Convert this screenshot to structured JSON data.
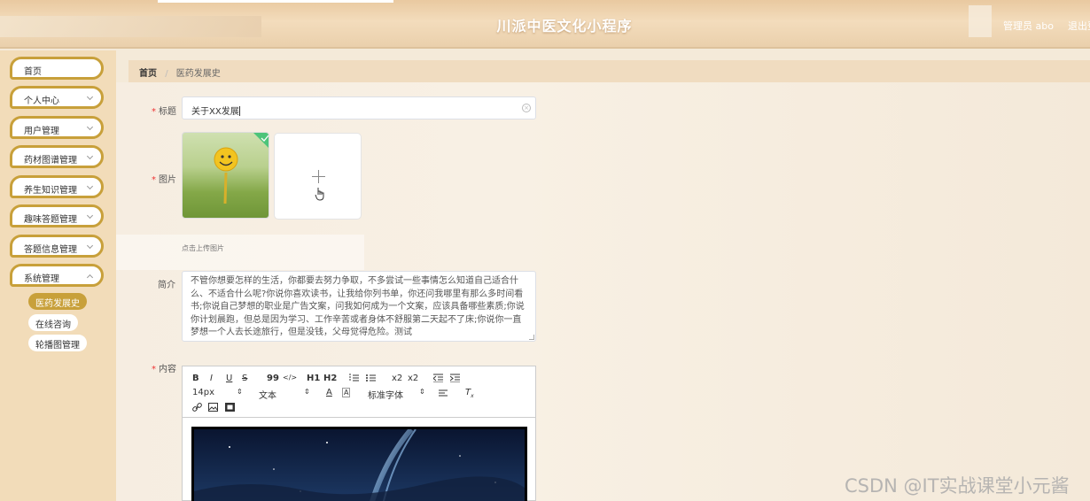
{
  "header": {
    "title": "川派中医文化小程序",
    "admin": "管理员 abo",
    "logout": "退出登"
  },
  "sidebar": {
    "items": [
      {
        "label": "首页"
      },
      {
        "label": "个人中心"
      },
      {
        "label": "用户管理"
      },
      {
        "label": "药材图谱管理"
      },
      {
        "label": "养生知识管理"
      },
      {
        "label": "趣味答题管理"
      },
      {
        "label": "答题信息管理"
      },
      {
        "label": "系统管理"
      }
    ],
    "sub_items": [
      {
        "label": "医药发展史",
        "active": true
      },
      {
        "label": "在线咨询"
      },
      {
        "label": "轮播图管理"
      }
    ]
  },
  "breadcrumb": {
    "home": "首页",
    "separator": "/",
    "current": "医药发展史"
  },
  "form": {
    "title_label": "标题",
    "title_value": "关于XX发展",
    "image_label": "图片",
    "upload_hint": "点击上传图片",
    "intro_label": "简介",
    "intro_value": "不管你想要怎样的生活，你都要去努力争取，不多尝试一些事情怎么知道自己适合什么、不适合什么呢?你说你喜欢读书，让我给你列书单，你还问我哪里有那么多时间看书;你说自己梦想的职业是广告文案，问我如何成为一个文案，应该具备哪些素质;你说你计划晨跑，但总是因为学习、工作辛苦或者身体不舒服第二天起不了床;你说你一直梦想一个人去长途旅行，但是没钱，父母觉得危险。测试",
    "content_label": "内容"
  },
  "editor_toolbar": {
    "bold": "B",
    "italic": "I",
    "underline": "U",
    "strike": "S",
    "quote": "99",
    "code": "</>",
    "h1": "H1",
    "h2": "H2",
    "subscript": "x2",
    "superscript": "x2",
    "font_size": "14px",
    "text_style": "文本",
    "font_family": "标准字体"
  },
  "colors": {
    "accent": "#c8a03a",
    "header_bg": "#ecd0a8",
    "sidebar_bg": "#f2dcb9"
  },
  "watermark": "CSDN @IT实战课堂小元酱"
}
